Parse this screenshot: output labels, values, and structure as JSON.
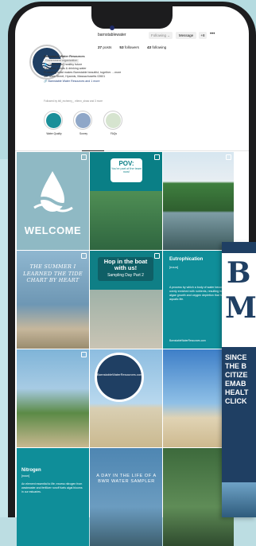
{
  "profile": {
    "username": "barnstablewater",
    "buttons": {
      "following": "Following ⌄",
      "message": "Message",
      "add": "+8",
      "more": "•••"
    },
    "stats": [
      {
        "count": "27",
        "label": "posts"
      },
      {
        "count": "53",
        "label": "followers"
      },
      {
        "count": "43",
        "label": "following"
      }
    ],
    "bio": {
      "name": "Barnstable Water Resources",
      "category": "Government organization",
      "line1": "💧 Clean water, healthy future",
      "line2": "Estuaries, ponds & drinking water",
      "line3": "Protecting what makes Barnstable beautiful, together. ...more",
      "address": "367 Main Street, Hyannis, Massachusetts 02601",
      "link": "🔗 Barnstable Water Resources and 1 more"
    },
    "followed_by": "Followed by bill_mchenry_, ellenn_shaw and 3 more"
  },
  "highlights": [
    {
      "label": "Water Quality",
      "color": "#1a8f99"
    },
    {
      "label": "Survey",
      "color": "#8fa7c8"
    },
    {
      "label": "FAQs",
      "color": "#d6e4cf"
    }
  ],
  "tabs": [
    "posts",
    "reels",
    "tagged"
  ],
  "posts": {
    "t1": {
      "text": "WELCOME"
    },
    "t2": {
      "headline": "POV:",
      "sub": "You're part of the team now!"
    },
    "t4": {
      "quote": "THE SUMMER I LEARNED THE TIDE CHART BY HEART"
    },
    "t5": {
      "headline": "Hop in the boat with us!",
      "sub": "Sampling Day Part 2"
    },
    "t6": {
      "title": "Eutrophication",
      "definition": "[noun]",
      "body": "A process by which a body of water becomes overly enriched with nutrients, resulting in algae growth and oxygen depletion that harms aquatic life.",
      "site": "BarnstableWaterResources.com"
    },
    "t8": {
      "seal": "BarnstableWaterResources.com"
    },
    "t10": {
      "title": "Nitrogen",
      "definition": "[noun]",
      "body": "An element essential to life; excess nitrogen from wastewater and fertilizer runoff fuels algal blooms in our estuaries."
    },
    "t11": {
      "text": "A DAY IN THE LIFE OF A BWR WATER SAMPLER"
    }
  },
  "overlay": {
    "letter1": "B",
    "letter2": "M",
    "text": "SINCE\nTHE B\nCITIZE\nEMAB\nHEALT\nCLICK"
  }
}
